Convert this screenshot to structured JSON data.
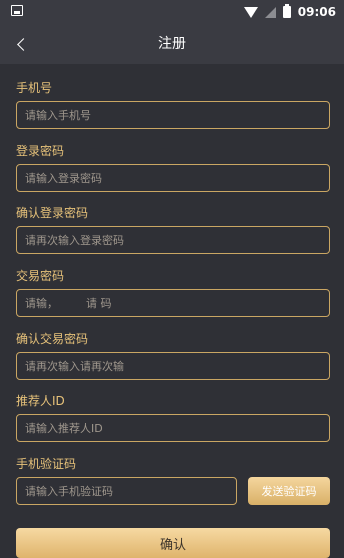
{
  "status_bar": {
    "time": "09:06"
  },
  "header": {
    "title": "注册"
  },
  "form": {
    "fields": [
      {
        "label": "手机号",
        "placeholder": "请输入手机号"
      },
      {
        "label": "登录密码",
        "placeholder": "请输入登录密码"
      },
      {
        "label": "确认登录密码",
        "placeholder": "请再次输入登录密码"
      },
      {
        "label": "交易密码",
        "placeholder": "请输，        请 码"
      },
      {
        "label": "确认交易密码",
        "placeholder": "请再次输入请再次输"
      },
      {
        "label": "推荐人ID",
        "placeholder": "请输入推荐人ID"
      },
      {
        "label": "手机验证码",
        "placeholder": "请输入手机验证码"
      }
    ],
    "send_code_label": "发送验证码",
    "confirm_label": "确认"
  },
  "colors": {
    "accent": "#e7c27a",
    "background": "#2f3036",
    "bar": "#3a3b42"
  }
}
